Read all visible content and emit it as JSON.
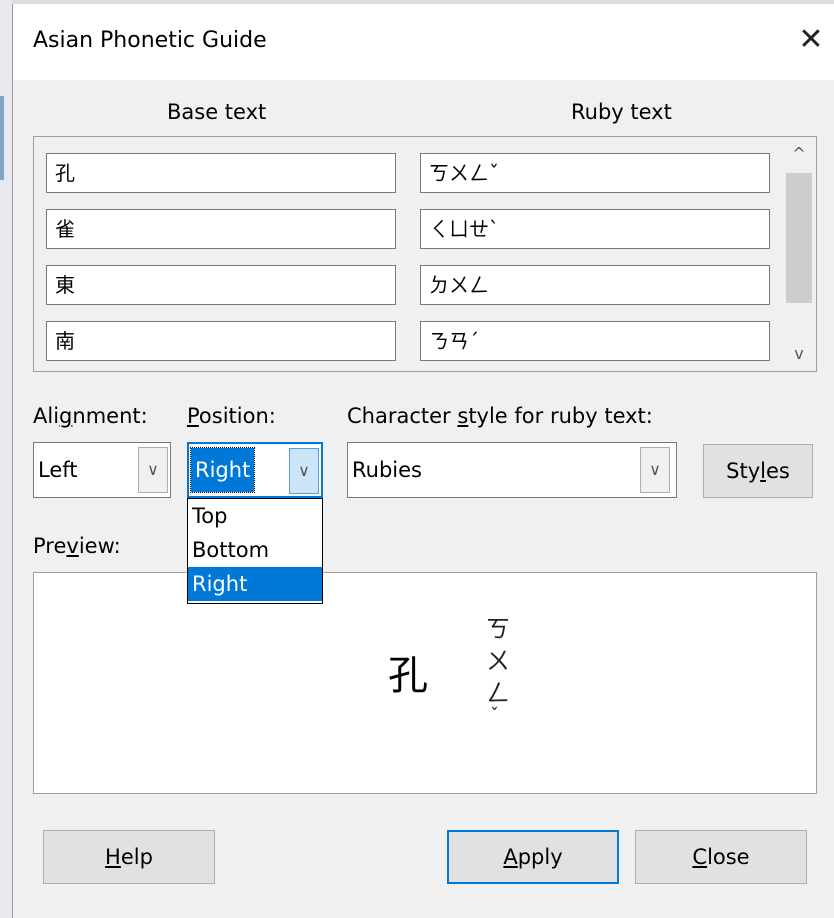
{
  "dialog": {
    "title": "Asian Phonetic Guide",
    "close_glyph": "✕"
  },
  "table": {
    "base_header": "Base text",
    "ruby_header": "Ruby text",
    "rows": [
      {
        "base": "孔",
        "ruby": "ㄎㄨㄥˇ"
      },
      {
        "base": "雀",
        "ruby": "ㄑㄩㄝˋ"
      },
      {
        "base": "東",
        "ruby": "ㄉㄨㄥ"
      },
      {
        "base": "南",
        "ruby": "ㄋㄢˊ"
      }
    ],
    "scroll_up": "^",
    "scroll_down": "v"
  },
  "alignment": {
    "label_pre": "Ali",
    "label_key": "g",
    "label_post": "nment:",
    "value": "Left"
  },
  "position": {
    "label_key": "P",
    "label_post": "osition:",
    "value": "Right",
    "options": [
      "Top",
      "Bottom",
      "Right"
    ]
  },
  "char_style": {
    "label_pre": "Character ",
    "label_key": "s",
    "label_post": "tyle for ruby text:",
    "value": "Rubies"
  },
  "styles_button": {
    "pre": "Sty",
    "key": "l",
    "post": "es"
  },
  "preview": {
    "label_pre": "Pre",
    "label_key": "v",
    "label_post": "iew:",
    "base_char": "孔",
    "ruby_chars": [
      "ㄎ",
      "ㄨ",
      "ㄥ",
      "ˇ"
    ]
  },
  "buttons": {
    "help_key": "H",
    "help_post": "elp",
    "apply_key": "A",
    "apply_post": "pply",
    "close_key": "C",
    "close_post": "lose"
  },
  "dropdown_arrow": "∨"
}
